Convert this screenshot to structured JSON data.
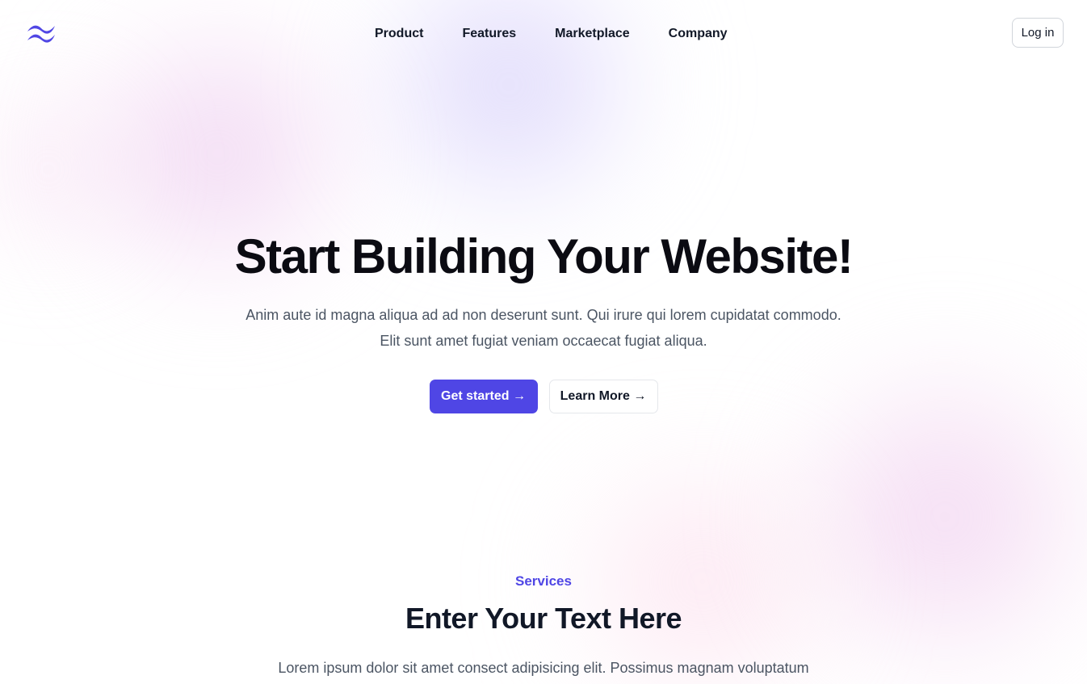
{
  "header": {
    "logo_icon": "tailwind-waves-icon",
    "nav": [
      {
        "label": "Product"
      },
      {
        "label": "Features"
      },
      {
        "label": "Marketplace"
      },
      {
        "label": "Company"
      }
    ],
    "login_label": "Log in"
  },
  "hero": {
    "title": "Start Building Your Website!",
    "description": "Anim aute id magna aliqua ad ad non deserunt sunt. Qui irure qui lorem cupidatat commodo. Elit sunt amet fugiat veniam occaecat fugiat aliqua.",
    "primary_button": "Get started →",
    "secondary_button": "Learn More →"
  },
  "services": {
    "eyebrow": "Services",
    "title": "Enter Your Text Here",
    "description": "Lorem ipsum dolor sit amet consect adipisicing elit. Possimus magnam voluptatum"
  },
  "colors": {
    "accent": "#4f46e5",
    "text_primary": "#111827",
    "text_secondary": "#4b5563"
  }
}
